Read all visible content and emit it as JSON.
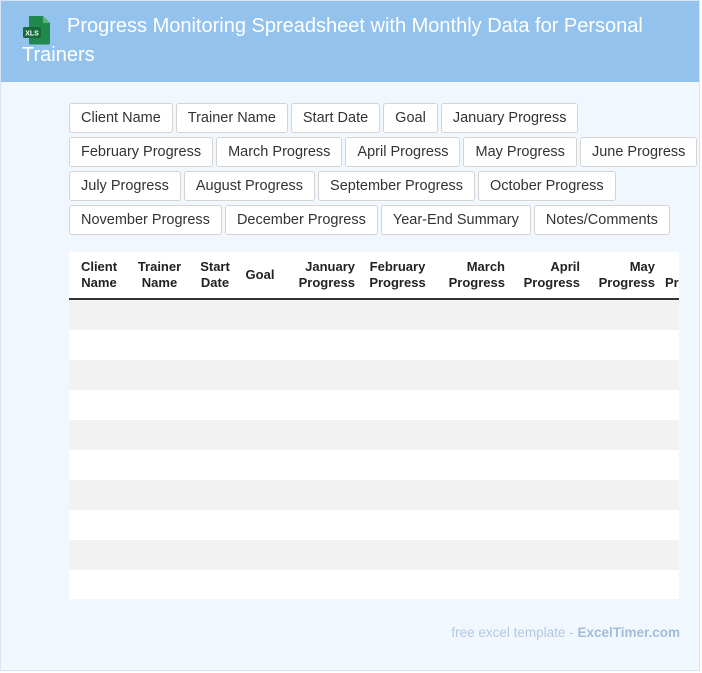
{
  "header": {
    "title": "Progress Monitoring Spreadsheet with Monthly Data for Personal Trainers",
    "icon": "xls-file-icon",
    "icon_label": "XLS",
    "color": "#93c2ec"
  },
  "tags": [
    "Client Name",
    "Trainer Name",
    "Start Date",
    "Goal",
    "January Progress",
    "February Progress",
    "March Progress",
    "April Progress",
    "May Progress",
    "June Progress",
    "July Progress",
    "August Progress",
    "September Progress",
    "October Progress",
    "November Progress",
    "December Progress",
    "Year-End Summary",
    "Notes/Comments"
  ],
  "table": {
    "headers": [
      {
        "line1": "Client",
        "line2": "Name"
      },
      {
        "line1": "Trainer",
        "line2": "Name"
      },
      {
        "line1": "Start",
        "line2": "Date"
      },
      {
        "line1": "Goal",
        "line2": ""
      },
      {
        "line1": "January",
        "line2": "Progress"
      },
      {
        "line1": "February",
        "line2": "Progress"
      },
      {
        "line1": "March",
        "line2": "Progress"
      },
      {
        "line1": "April",
        "line2": "Progress"
      },
      {
        "line1": "May",
        "line2": "Progress"
      },
      {
        "line1": "",
        "line2": "Progress"
      }
    ],
    "row_count": 10
  },
  "footer": {
    "text": "free excel template - ",
    "brand": "ExcelTimer.com"
  }
}
